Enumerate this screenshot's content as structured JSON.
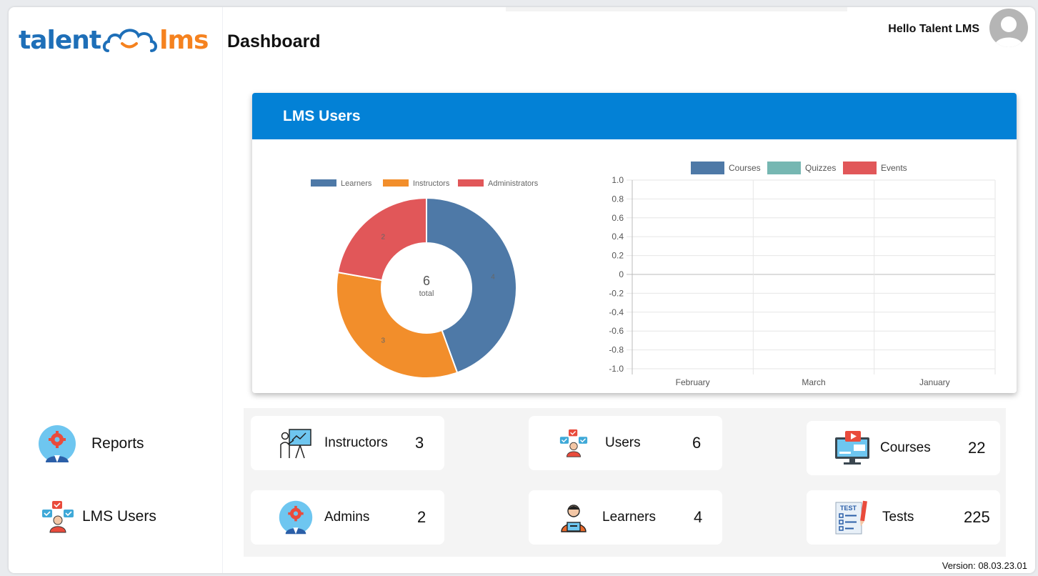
{
  "logo": {
    "part1": "talent",
    "part2": "lms"
  },
  "header": {
    "title": "Dashboard",
    "greeting": "Hello Talent LMS"
  },
  "sidebar": {
    "items": [
      {
        "label": "Reports",
        "icon": "gear-person-icon"
      },
      {
        "label": "LMS Users",
        "icon": "users-network-icon"
      }
    ]
  },
  "card": {
    "title": "LMS Users"
  },
  "colors": {
    "accent": "#0381d6",
    "learners": "#4e79a7",
    "instructors": "#f28e2b",
    "administrators": "#e15759",
    "quizzes": "#76b7b2"
  },
  "chart_data": [
    {
      "type": "pie",
      "legend": [
        "Learners",
        "Instructors",
        "Administrators"
      ],
      "values": [
        4,
        3,
        2
      ],
      "labels": [
        "4",
        "3",
        "2"
      ],
      "center_value": "6",
      "center_label": "total"
    },
    {
      "type": "bar",
      "categories": [
        "February",
        "March",
        "January"
      ],
      "series": [
        {
          "name": "Courses",
          "values": [
            0,
            0,
            0
          ]
        },
        {
          "name": "Quizzes",
          "values": [
            0,
            0,
            0
          ]
        },
        {
          "name": "Events",
          "values": [
            0,
            0,
            0
          ]
        }
      ],
      "ylim": [
        -1.0,
        1.0
      ],
      "yticks": [
        "1.0",
        "0.8",
        "0.6",
        "0.4",
        "0.2",
        "0",
        "-0.2",
        "-0.4",
        "-0.6",
        "-0.8",
        "-1.0"
      ],
      "grid": true,
      "legend_position": "top"
    }
  ],
  "stats": [
    {
      "label": "Instructors",
      "value": "3",
      "icon": "presentation-icon"
    },
    {
      "label": "Users",
      "value": "6",
      "icon": "users-network-icon"
    },
    {
      "label": "Courses",
      "value": "22",
      "icon": "video-monitor-icon"
    },
    {
      "label": "Admins",
      "value": "2",
      "icon": "gear-person-icon"
    },
    {
      "label": "Learners",
      "value": "4",
      "icon": "learner-laptop-icon"
    },
    {
      "label": "Tests",
      "value": "225",
      "icon": "test-checklist-icon"
    }
  ],
  "footer": {
    "version": "Version: 08.03.23.01"
  }
}
